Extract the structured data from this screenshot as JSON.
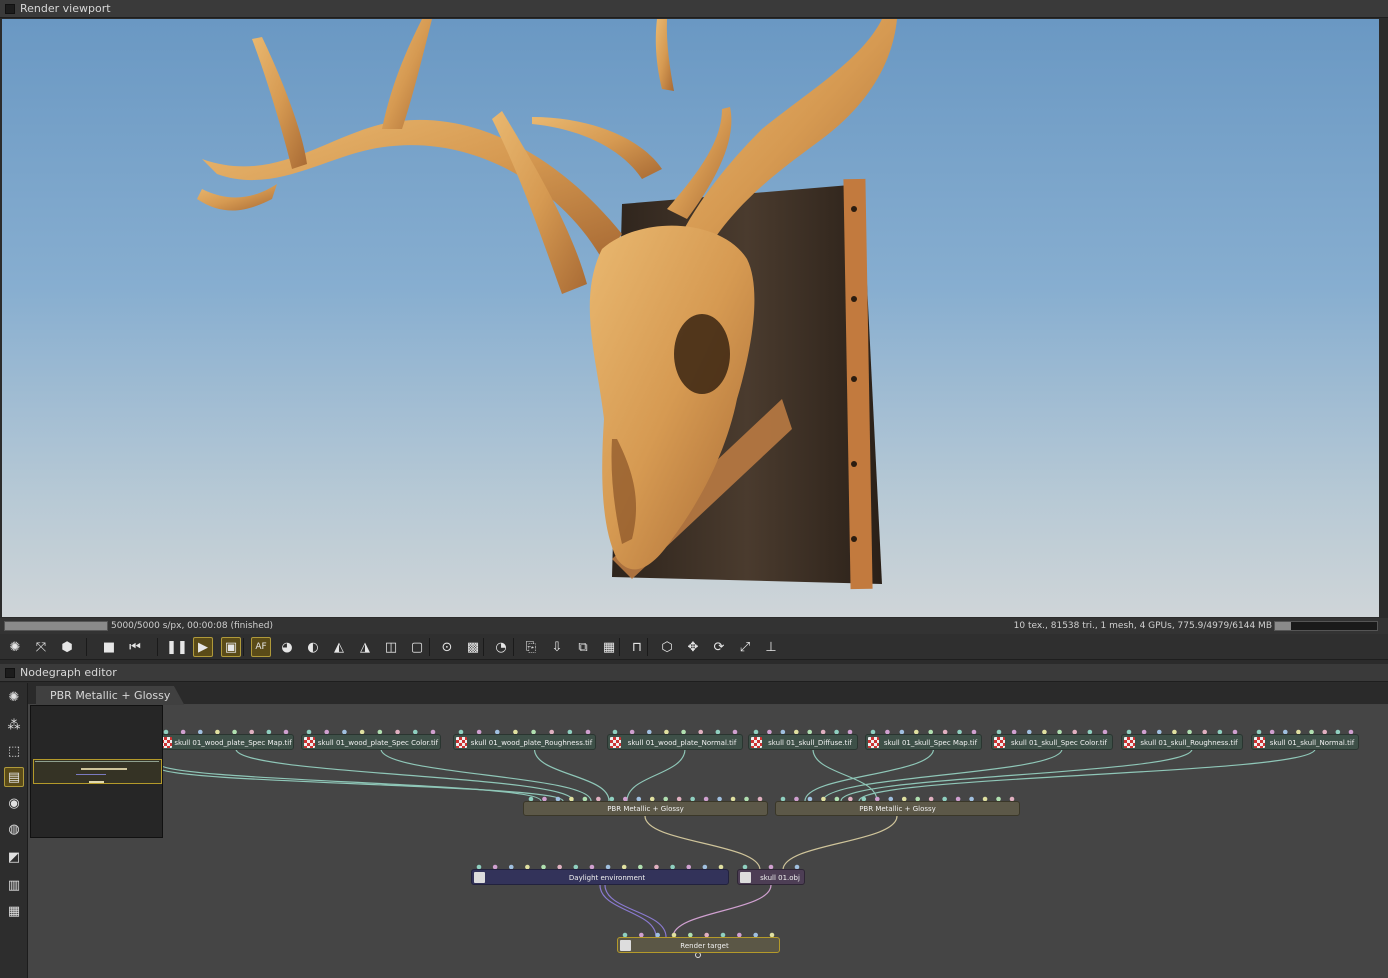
{
  "render_viewport": {
    "title": "Render viewport",
    "progress": 1.0,
    "status_left": "5000/5000 s/px, 00:00:08 (finished)",
    "status_right": "10 tex., 81538 tri., 1 mesh, 4 GPUs, 775.9/4979/6144 MB",
    "memory_usage": 0.16
  },
  "toolbar": {
    "buttons": [
      {
        "name": "octane-logo-icon",
        "glyph": "✺"
      },
      {
        "name": "reset-view-icon",
        "glyph": "⤧"
      },
      {
        "name": "cube-display-icon",
        "glyph": "⬢"
      },
      {
        "name": "stop-icon",
        "glyph": "■"
      },
      {
        "name": "restart-icon",
        "glyph": "⏮"
      },
      {
        "name": "pause-icon",
        "glyph": "❚❚"
      },
      {
        "name": "play-icon",
        "glyph": "▶"
      },
      {
        "name": "monitor-icon",
        "glyph": "▣"
      },
      {
        "name": "af-icon",
        "glyph": "AF"
      },
      {
        "name": "color-wheel-icon",
        "glyph": "◕"
      },
      {
        "name": "material-picker-icon",
        "glyph": "◐"
      },
      {
        "name": "focus-picker-icon",
        "glyph": "◭"
      },
      {
        "name": "white-balance-picker-icon",
        "glyph": "◮"
      },
      {
        "name": "region-icon",
        "glyph": "◫"
      },
      {
        "name": "film-region-icon",
        "glyph": "▢"
      },
      {
        "name": "zoom-icon",
        "glyph": "⊙"
      },
      {
        "name": "alpha-icon",
        "glyph": "▩"
      },
      {
        "name": "gauge-icon",
        "glyph": "◔"
      },
      {
        "name": "clipboard-icon",
        "glyph": "⎘"
      },
      {
        "name": "save-image-icon",
        "glyph": "⇩"
      },
      {
        "name": "copy-image-icon",
        "glyph": "⧉"
      },
      {
        "name": "checker-icon",
        "glyph": "▦"
      },
      {
        "name": "lock-icon",
        "glyph": "⊓"
      },
      {
        "name": "viewport-cube-icon",
        "glyph": "⬡"
      },
      {
        "name": "move-icon",
        "glyph": "✥"
      },
      {
        "name": "rotate-icon",
        "glyph": "⟳"
      },
      {
        "name": "scale-icon",
        "glyph": "⤢"
      },
      {
        "name": "axis-icon",
        "glyph": "⊥"
      }
    ]
  },
  "nodegraph": {
    "title": "Nodegraph editor",
    "tab": "PBR Metallic + Glossy",
    "side_buttons": [
      {
        "name": "octane-logo-icon",
        "glyph": "✺"
      },
      {
        "name": "arrange-icon",
        "glyph": "⁂"
      },
      {
        "name": "select-icon",
        "glyph": "⬚"
      },
      {
        "name": "minimap-icon",
        "glyph": "▤"
      },
      {
        "name": "material-ball-icon",
        "glyph": "◉"
      },
      {
        "name": "sphere-icon",
        "glyph": "◍"
      },
      {
        "name": "texture-icon",
        "glyph": "◩"
      },
      {
        "name": "grid-magnet-icon",
        "glyph": "▥"
      },
      {
        "name": "grid-icon",
        "glyph": "▦"
      }
    ],
    "texture_nodes": [
      "skull 01_wood_plate_Spec Map.tif",
      "skull 01_wood_plate_Spec Color.tif",
      "skull 01_wood_plate_Roughness.tif",
      "skull 01_wood_plate_Normal.tif",
      "skull 01_skull_Diffuse.tif",
      "skull 01_skull_Spec Map.tif",
      "skull 01_skull_Spec Color.tif",
      "skull 01_skull_Roughness.tif",
      "skull 01_skull_Normal.tif"
    ],
    "material_nodes": [
      "PBR Metallic + Glossy",
      "PBR Metallic + Glossy"
    ],
    "environment_node": "Daylight environment",
    "geometry_node": "skull 01.obj",
    "render_target_node": "Render target",
    "colors": {
      "texture": "#3e5048",
      "material": "#5c5848",
      "environment": "#33335a",
      "geometry": "#4d3e55",
      "accent": "#b49a2a"
    }
  }
}
